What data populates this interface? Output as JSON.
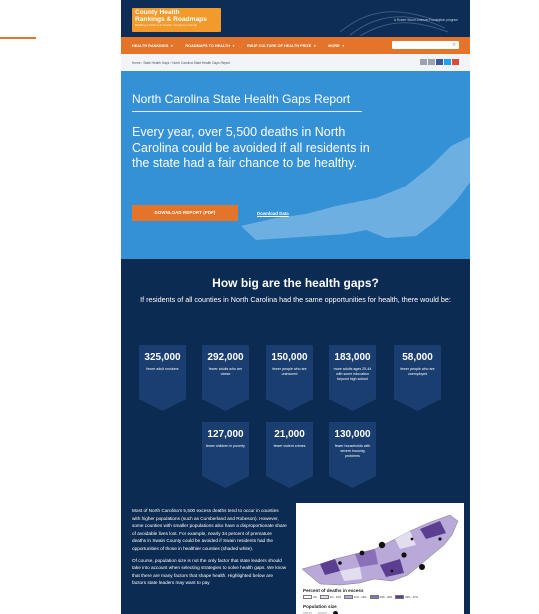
{
  "logo": {
    "line1": "County Health",
    "line2": "Rankings & Roadmaps",
    "tagline": "Building a Culture of Health, County by County"
  },
  "rwjf_label": "A Robert Wood Johnson Foundation program",
  "nav": {
    "items": [
      "HEALTH RANKINGS",
      "ROADMAPS TO HEALTH",
      "RWJF CULTURE OF HEALTH PRIZE",
      "MORE"
    ],
    "search_placeholder": ""
  },
  "breadcrumb": "Home › State Health Gaps › North Carolina State Health Gaps Report",
  "share_icons": [
    {
      "name": "email-share-icon",
      "color": "#9aa4b0"
    },
    {
      "name": "print-share-icon",
      "color": "#9aa4b0"
    },
    {
      "name": "facebook-share-icon",
      "color": "#3b5998"
    },
    {
      "name": "twitter-share-icon",
      "color": "#1da1f2"
    },
    {
      "name": "google-plus-share-icon",
      "color": "#dd4b39"
    }
  ],
  "hero": {
    "title": "North Carolina State Health Gaps Report",
    "lead": "Every year, over 5,500 deaths in North Carolina could be avoided if all residents in the state had a fair chance to be healthy.",
    "download_button": "DOWNLOAD REPORT (PDF)",
    "download_data": "Download Data"
  },
  "gaps": {
    "title": "How big are the health gaps?",
    "subtitle": "If residents of all counties in North Carolina had the same opportunities for health, there would be:",
    "stats": [
      {
        "number": "325,000",
        "label": "fewer adult smokers"
      },
      {
        "number": "292,000",
        "label": "fewer adults who are obese"
      },
      {
        "number": "150,000",
        "label": "fewer people who are uninsured"
      },
      {
        "number": "183,000",
        "label": "more adults ages 25-44 with some education beyond high school"
      },
      {
        "number": "58,000",
        "label": "fewer people who are unemployed"
      },
      {
        "number": "127,000",
        "label": "fewer children in poverty"
      },
      {
        "number": "21,000",
        "label": "fewer violent crimes"
      },
      {
        "number": "130,000",
        "label": "fewer households with severe housing problems"
      }
    ],
    "paragraph1": "Most of North Carolina's 5,500 excess deaths tend to occur in counties with higher populations (such as Cumberland and Robeson). However, some counties with smaller populations also have a disproportionate share of avoidable lives lost. For example, nearly 34 percent of premature deaths in Swain County could be avoided if Swain residents had the opportunities of those in healthier counties (shaded white).",
    "paragraph2": "Of course, population size is not the only factor that state leaders should take into account when selecting strategies to solve health gaps. We know that there are many factors that shape health. Highlighted below are factors state leaders may want to pay"
  },
  "map": {
    "legend_title": "Percent of deaths in excess",
    "legend": [
      {
        "label": "0%",
        "color": "#ffffff"
      },
      {
        "label": "1% - 10%",
        "color": "#e3ddf0"
      },
      {
        "label": "11% - 19%",
        "color": "#b9a9d8"
      },
      {
        "label": "20% - 28%",
        "color": "#8a70b8"
      },
      {
        "label": "29% - 37%",
        "color": "#5b3e8f"
      }
    ],
    "pop_title": "Population size"
  }
}
